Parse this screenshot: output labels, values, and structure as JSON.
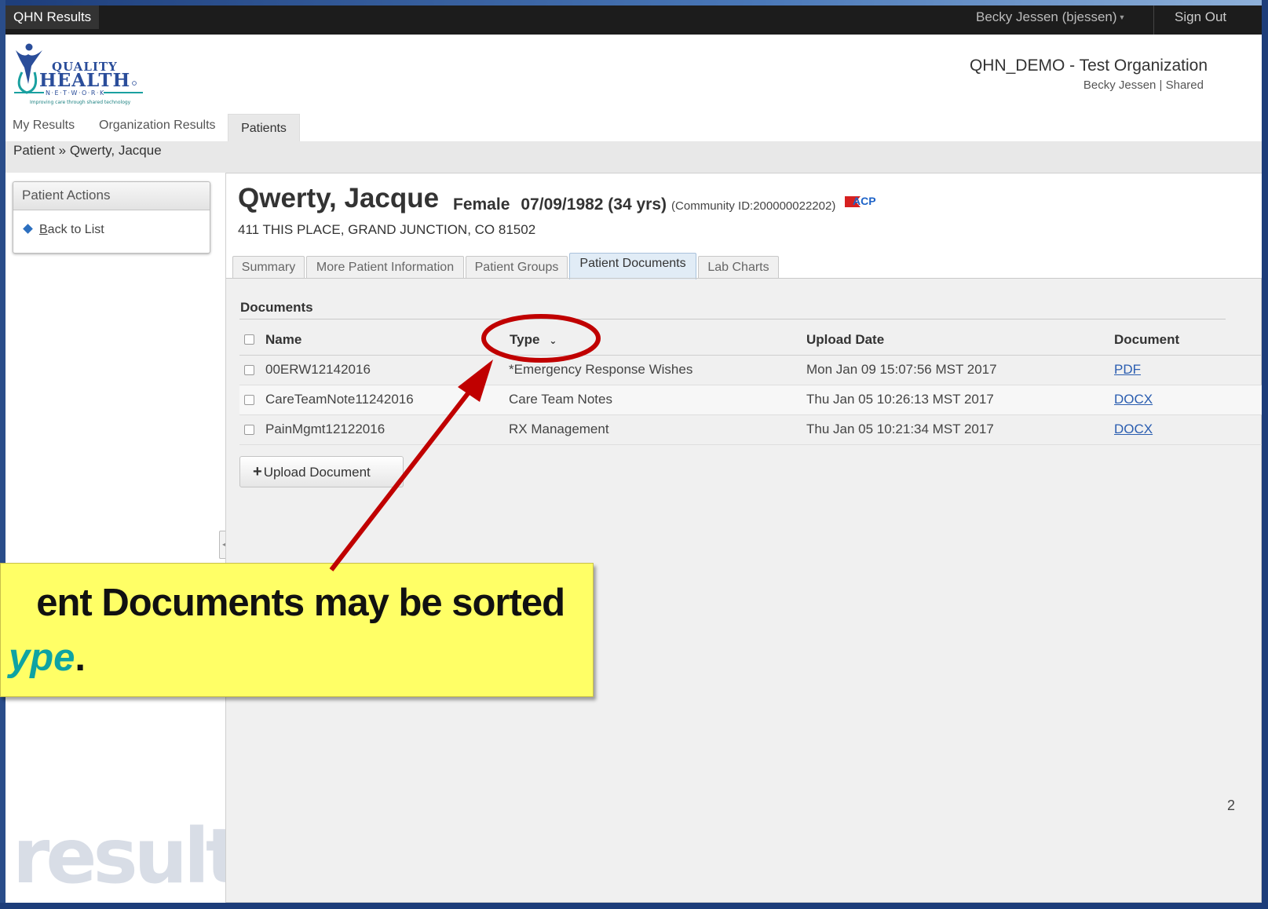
{
  "topbar": {
    "app_name": "QHN Results",
    "user_menu": "Becky Jessen (bjessen)",
    "sign_out": "Sign Out"
  },
  "header": {
    "logo_text": "QUALITY HEALTH NETWORK",
    "logo_tagline": "Improving care through shared technology",
    "org_name": "QHN_DEMO - Test Organization",
    "org_sub": "Becky Jessen  |  Shared"
  },
  "nav": {
    "items": [
      "My Results",
      "Organization Results"
    ],
    "active": "Patients"
  },
  "breadcrumb": "Patient » Qwerty, Jacque",
  "sidebar": {
    "title": "Patient Actions",
    "back_prefix": "B",
    "back_rest": "ack to List",
    "watermark": "results"
  },
  "patient": {
    "name": "Qwerty, Jacque",
    "gender": "Female",
    "dob": "07/09/1982 (34 yrs)",
    "community": "(Community ID:200000022202)",
    "badge": "ACP",
    "address": "411 THIS PLACE, GRAND JUNCTION, CO 81502"
  },
  "tabs": [
    "Summary",
    "More Patient Information",
    "Patient Groups",
    "Patient Documents",
    "Lab Charts"
  ],
  "active_tab": "Patient Documents",
  "documents": {
    "title": "Documents",
    "columns": [
      "Name",
      "Type",
      "Upload Date",
      "Document"
    ],
    "sort_indicator": "⌄",
    "rows": [
      {
        "name": "00ERW12142016",
        "type": "*Emergency Response Wishes",
        "date": "Mon Jan 09 15:07:56 MST 2017",
        "doc": "PDF"
      },
      {
        "name": "CareTeamNote11242016",
        "type": "Care Team Notes",
        "date": "Thu Jan 05 10:26:13 MST 2017",
        "doc": "DOCX"
      },
      {
        "name": "PainMgmt12122016",
        "type": "RX Management",
        "date": "Thu Jan 05 10:21:34 MST 2017",
        "doc": "DOCX"
      }
    ],
    "upload_label": "Upload Document"
  },
  "corner_mark": "2",
  "callout": {
    "line1": "ent Documents may be sorted",
    "line2_em": "ype",
    "line2_end": ".",
    "colors": {
      "background": "#ffff66",
      "emphasis": "#0ea3a3",
      "arrow": "#c00000"
    }
  }
}
